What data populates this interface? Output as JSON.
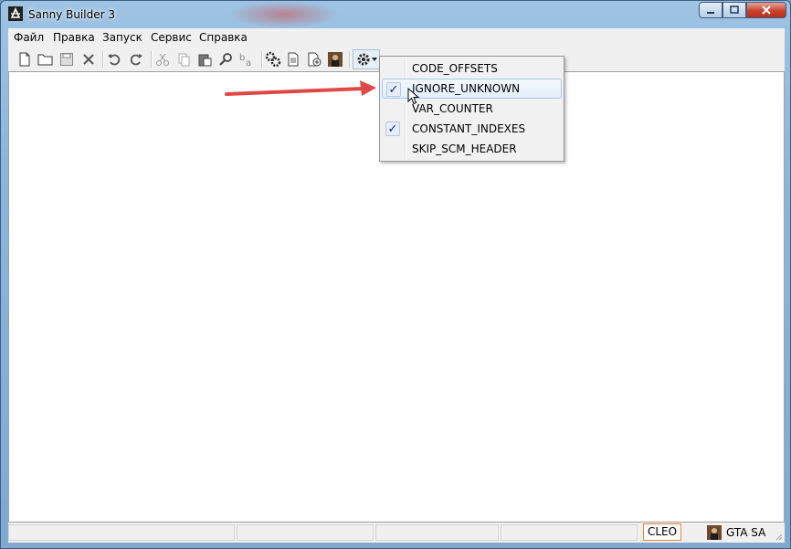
{
  "window": {
    "title": "Sanny Builder 3",
    "accent": "#8db6db",
    "close_color": "#c9432f"
  },
  "menu": [
    "Файл",
    "Правка",
    "Запуск",
    "Сервис",
    "Справка"
  ],
  "toolbar": {
    "icons": [
      "new-file-icon",
      "open-folder-icon",
      "save-icon",
      "close-file-icon",
      "undo-icon",
      "redo-icon",
      "cut-icon",
      "copy-icon",
      "paste-icon",
      "find-icon",
      "replace-icon",
      "compile-icon",
      "decompile-icon",
      "compile-run-icon",
      "game-icon",
      "options-gear-icon"
    ]
  },
  "options_menu": {
    "items": [
      {
        "label": "CODE_OFFSETS",
        "checked": false
      },
      {
        "label": "IGNORE_UNKNOWN",
        "checked": true
      },
      {
        "label": "VAR_COUNTER",
        "checked": false
      },
      {
        "label": "CONSTANT_INDEXES",
        "checked": true
      },
      {
        "label": "SKIP_SCM_HEADER",
        "checked": false
      }
    ],
    "check_glyph": "✓"
  },
  "status": {
    "mode": "CLEO",
    "game": "GTA SA",
    "mode_border": "#e8873a"
  },
  "annotation": {
    "arrow_color": "#e04848"
  }
}
